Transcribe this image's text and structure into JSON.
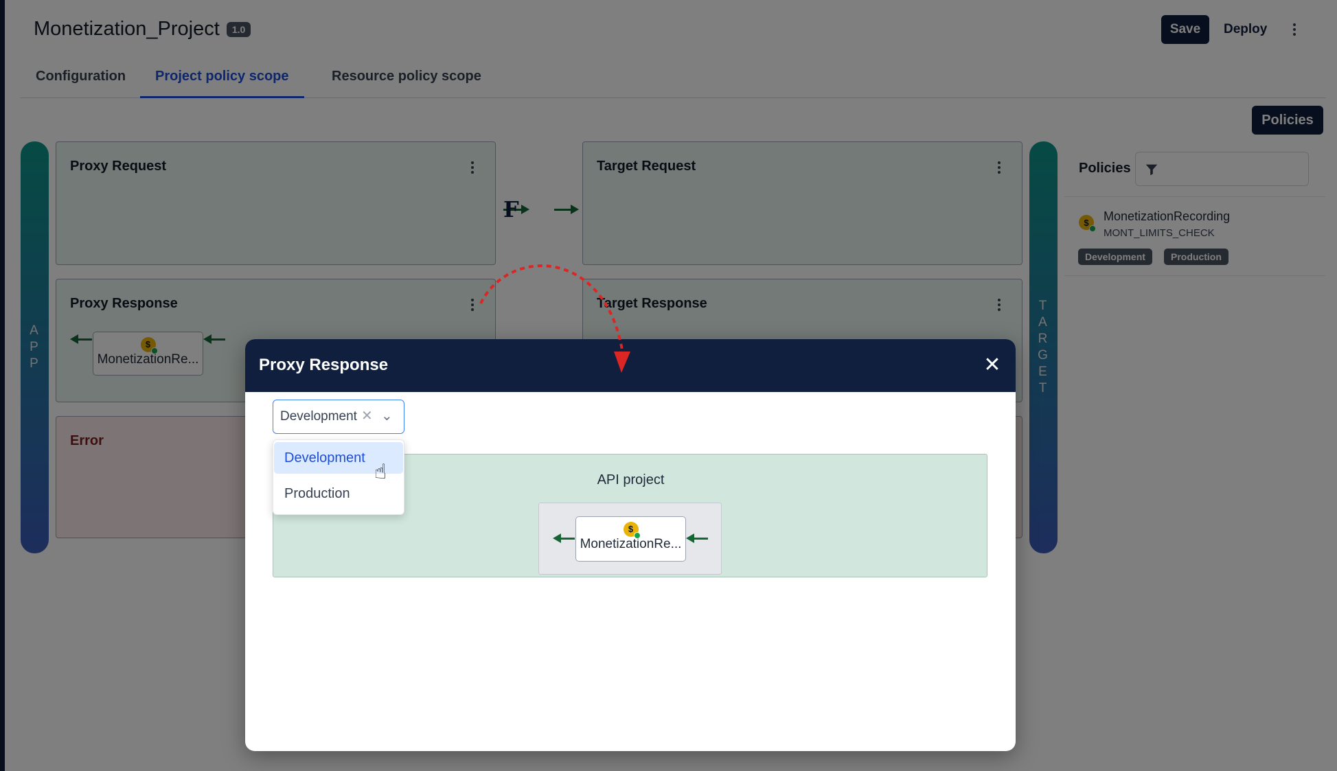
{
  "project": {
    "title": "Monetization_Project",
    "version": "1.0"
  },
  "header": {
    "save_label": "Save",
    "deploy_label": "Deploy"
  },
  "tabs": [
    {
      "label": "Configuration"
    },
    {
      "label": "Project policy scope"
    },
    {
      "label": "Resource policy scope"
    }
  ],
  "policies_button": "Policies",
  "flow": {
    "app_label": [
      "A",
      "P",
      "P"
    ],
    "target_label": [
      "T",
      "A",
      "R",
      "G",
      "E",
      "T"
    ],
    "proxy_request": "Proxy Request",
    "target_request": "Target Request",
    "proxy_response": "Proxy Response",
    "target_response": "Target Response",
    "error": "Error",
    "f_glyph": "F",
    "chip_label": "MonetizationRe..."
  },
  "policies_panel": {
    "label": "Policies",
    "item": {
      "name": "MonetizationRecording",
      "code": "MONT_LIMITS_CHECK",
      "tags": [
        "Development",
        "Production"
      ]
    }
  },
  "modal": {
    "title": "Proxy Response",
    "close_glyph": "✕",
    "select": {
      "value": "Development",
      "clear_glyph": "✕",
      "chevron_glyph": "⌄"
    },
    "options": [
      "Development",
      "Production"
    ],
    "scope_label": "API project",
    "chip_label": "MonetizationRe..."
  },
  "icons": {
    "coin": "$"
  },
  "colors": {
    "navy": "#0f1f3d",
    "accent_blue": "#1d4ed8",
    "flow_green": "#166534",
    "dashed_red": "#dc2626"
  }
}
